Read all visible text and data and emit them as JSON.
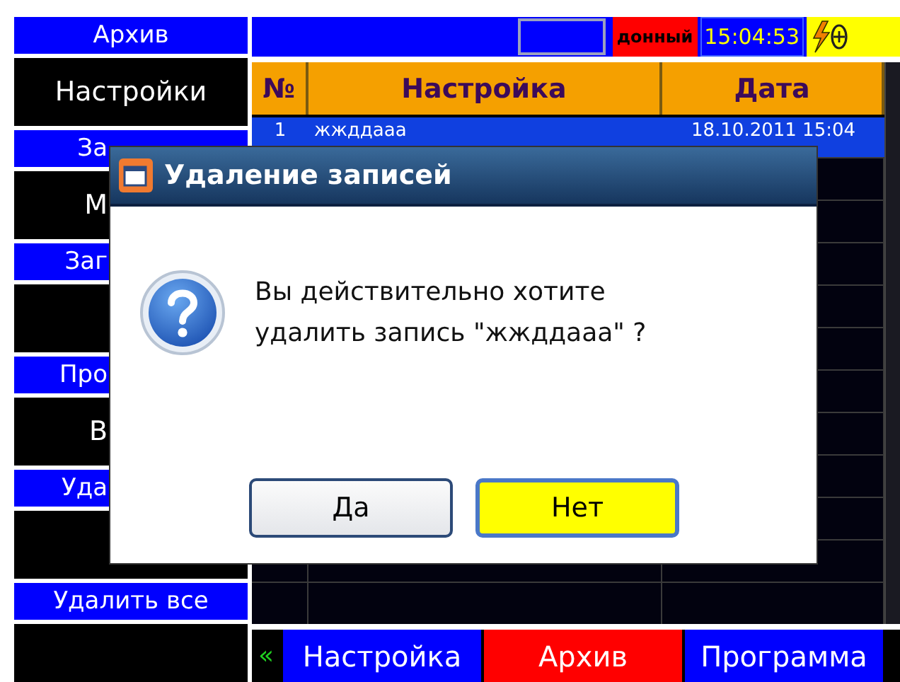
{
  "sidebar": {
    "items": [
      {
        "label": "Архив",
        "kind": "header"
      },
      {
        "label": "Настройки",
        "kind": "button"
      },
      {
        "label": "За",
        "kind": "header"
      },
      {
        "label": "М",
        "kind": "button"
      },
      {
        "label": "Заг",
        "kind": "header"
      },
      {
        "kind": "button"
      },
      {
        "label": "Про",
        "kind": "header"
      },
      {
        "label": "В",
        "kind": "button"
      },
      {
        "label": "Уда",
        "kind": "header"
      },
      {
        "kind": "button"
      },
      {
        "label": "Удалить все",
        "kind": "header"
      },
      {
        "kind": "button"
      }
    ]
  },
  "top_bar": {
    "mode": "донный",
    "time": "15:04:53"
  },
  "table": {
    "columns": [
      "№",
      "Настройка",
      "Дата"
    ],
    "rows": [
      {
        "cells": [
          "1",
          "жжддааа",
          "18.10.2011 15:04"
        ],
        "selected": true
      }
    ]
  },
  "bottom_nav": {
    "prev": "«",
    "items": [
      {
        "label": "Настройка",
        "selected": false
      },
      {
        "label": "Архив",
        "selected": true
      },
      {
        "label": "Программа",
        "selected": false
      }
    ]
  },
  "dialog": {
    "title": "Удаление записей",
    "message_lines": [
      "Вы действительно хотите",
      "удалить запись \"жжддааа\" ?"
    ],
    "buttons": [
      {
        "label": "Да",
        "selected": false
      },
      {
        "label": "Нет",
        "selected": true
      }
    ]
  }
}
